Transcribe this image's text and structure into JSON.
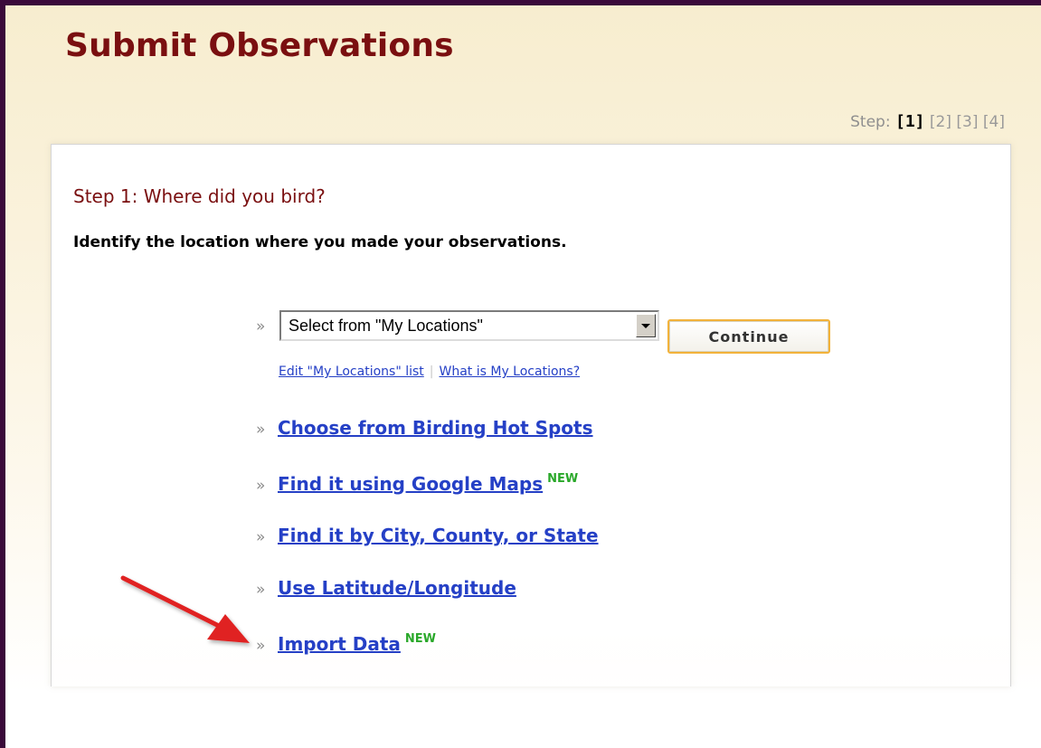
{
  "page": {
    "title": "Submit Observations"
  },
  "steps": {
    "prefix": "Step:",
    "current": "[1]",
    "others": [
      "[2]",
      "[3]",
      "[4]"
    ]
  },
  "step1": {
    "heading": "Step 1: Where did you bird?",
    "description": "Identify the location where you made your observations.",
    "location_select": {
      "value": "Select from \"My Locations\""
    },
    "continue_label": "Continue",
    "edit_list_link": "Edit \"My Locations\" list",
    "separator": "|",
    "what_is_link": "What is My Locations?",
    "options": [
      {
        "label": "Choose from Birding Hot Spots",
        "badge": ""
      },
      {
        "label": "Find it using Google Maps",
        "badge": "NEW"
      },
      {
        "label": "Find it by City, County, or State",
        "badge": ""
      },
      {
        "label": "Use Latitude/Longitude",
        "badge": ""
      },
      {
        "label": "Import Data",
        "badge": "NEW"
      }
    ],
    "bullet": "»"
  },
  "colors": {
    "title": "#7a0f10",
    "link": "#2540c6",
    "new_badge": "#2aa82a",
    "button_border": "#f2b23a",
    "annotation_arrow": "#e02020"
  }
}
